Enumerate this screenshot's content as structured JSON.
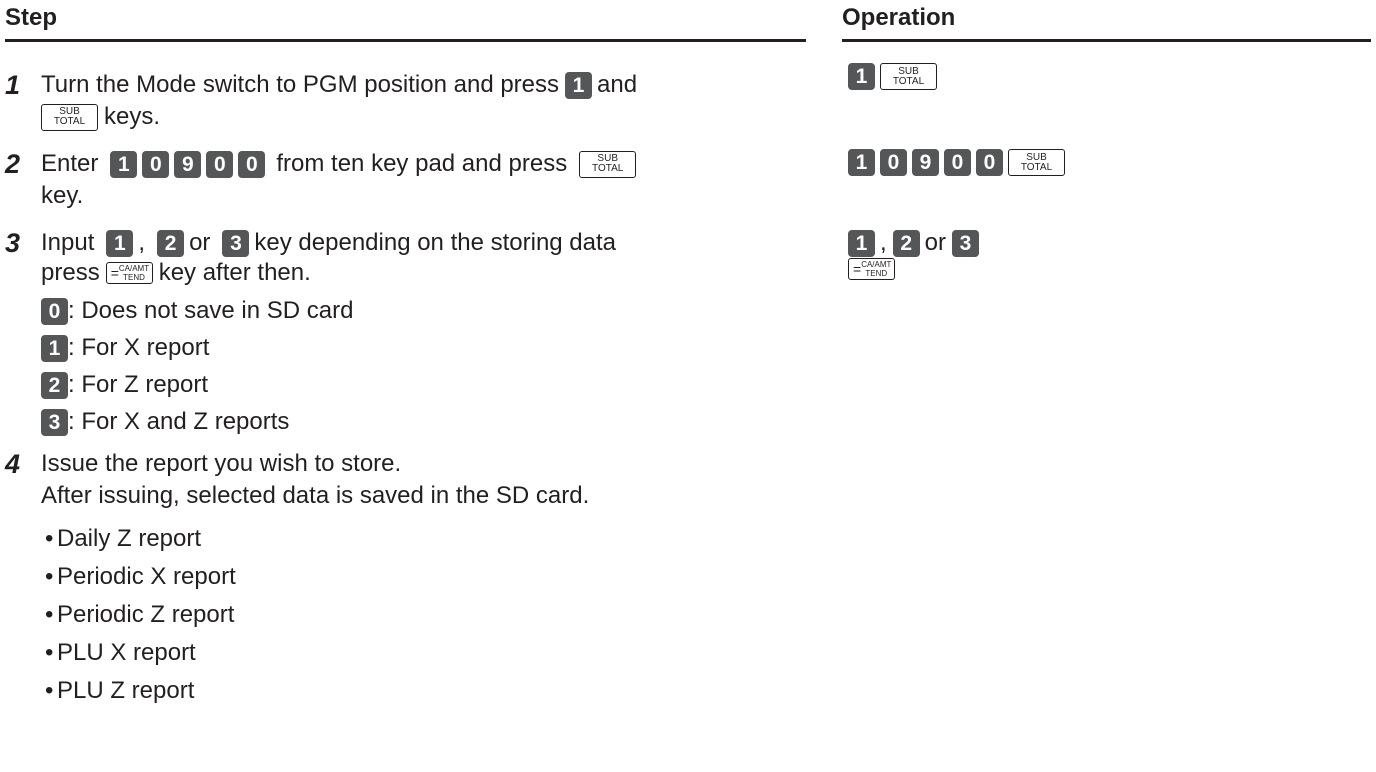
{
  "header": {
    "step": "Step",
    "operation": "Operation"
  },
  "keys": {
    "sub": "SUB",
    "total": "TOTAL",
    "eq": "=",
    "ca": "CA/AMT",
    "tend": "TEND"
  },
  "steps": [
    {
      "n": "1",
      "l1a": "Turn the Mode switch to PGM position and press",
      "l1b": "and",
      "l2": "keys."
    },
    {
      "n": "2",
      "la": "Enter",
      "lb": "from ten key pad and press",
      "l2": "key."
    },
    {
      "n": "3",
      "la": "Input",
      "comma": ",",
      "or": "or",
      "lb": "key depending on the storing data",
      "l2a": "press",
      "l2b": "key after then."
    },
    {
      "n": "4",
      "l1": "Issue the report you wish to store.",
      "l2": "After issuing, selected data is saved in the SD card."
    }
  ],
  "options": [
    {
      "key": "0",
      "text": ": Does not save in SD card"
    },
    {
      "key": "1",
      "text": ": For X report"
    },
    {
      "key": "2",
      "text": ": For Z report"
    },
    {
      "key": "3",
      "text": ": For X and Z reports"
    }
  ],
  "reports": [
    "Daily Z report",
    "Periodic X report",
    "Periodic Z report",
    "PLU X report",
    "PLU Z report"
  ],
  "digits": {
    "d1": "1",
    "d0": "0",
    "d9": "9",
    "d2": "2",
    "d3": "3"
  },
  "bullet": "•",
  "colors": {
    "text": "#231f20",
    "key_fill": "#555658"
  }
}
